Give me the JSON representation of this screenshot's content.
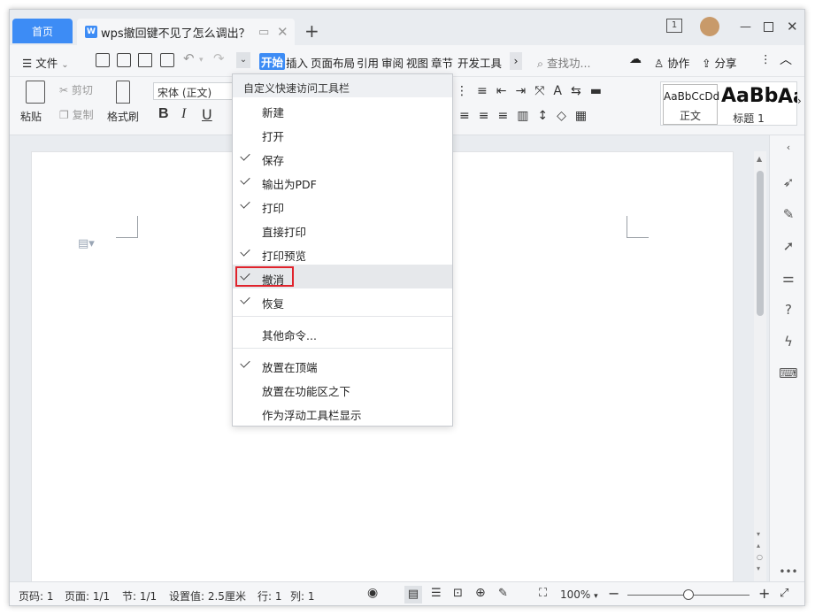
{
  "tabs": {
    "home": "首页",
    "doc_title": "wps撤回键不见了怎么调出？"
  },
  "window": {
    "badge": "1"
  },
  "menu": {
    "file": "文件",
    "tabs": [
      "开始",
      "插入",
      "页面布局",
      "引用",
      "审阅",
      "视图",
      "章节",
      "开发工具"
    ],
    "search": "查找功...",
    "collab": "协作",
    "share": "分享"
  },
  "ribbon": {
    "paste": "粘贴",
    "cut": "剪切",
    "copy": "复制",
    "format_painter": "格式刷",
    "font": "宋体 (正文)",
    "bold": "B",
    "italic": "I",
    "underline": "U",
    "style_normal_preview": "AaBbCcDd",
    "style_normal": "正文",
    "style_h1_preview": "AaBb",
    "style_h1": "标题 1",
    "style_h2_preview": "Aa"
  },
  "dropdown": {
    "header": "自定义快速访问工具栏",
    "items": [
      {
        "label": "新建",
        "checked": false
      },
      {
        "label": "打开",
        "checked": false
      },
      {
        "label": "保存",
        "checked": true
      },
      {
        "label": "输出为PDF",
        "checked": true
      },
      {
        "label": "打印",
        "checked": true
      },
      {
        "label": "直接打印",
        "checked": false
      },
      {
        "label": "打印预览",
        "checked": true
      },
      {
        "label": "撤消",
        "checked": true
      },
      {
        "label": "恢复",
        "checked": true
      }
    ],
    "more": "其他命令...",
    "position_items": [
      {
        "label": "放置在顶端",
        "checked": true
      },
      {
        "label": "放置在功能区之下",
        "checked": false
      },
      {
        "label": "作为浮动工具栏显示",
        "checked": false
      }
    ]
  },
  "status": {
    "page": "页码: 1",
    "pages": "页面: 1/1",
    "section": "节: 1/1",
    "setting": "设置值: 2.5厘米",
    "row": "行: 1",
    "col": "列: 1",
    "zoom": "100%",
    "zoom_level": 0.5
  }
}
